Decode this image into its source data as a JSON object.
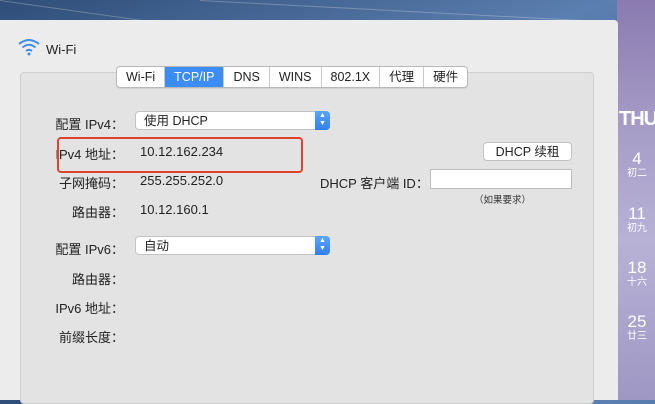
{
  "window": {
    "title": "Wi-Fi"
  },
  "tabs": [
    {
      "label": "Wi-Fi",
      "active": false
    },
    {
      "label": "TCP/IP",
      "active": true
    },
    {
      "label": "DNS",
      "active": false
    },
    {
      "label": "WINS",
      "active": false
    },
    {
      "label": "802.1X",
      "active": false
    },
    {
      "label": "代理",
      "active": false
    },
    {
      "label": "硬件",
      "active": false
    }
  ],
  "ipv4": {
    "config_label": "配置 IPv4：",
    "config_value": "使用 DHCP",
    "address_label": "IPv4 地址：",
    "address_value": "10.12.162.234",
    "subnet_label": "子网掩码：",
    "subnet_value": "255.255.252.0",
    "router_label": "路由器：",
    "router_value": "10.12.160.1",
    "renew_button": "DHCP 续租",
    "client_id_label": "DHCP 客户端 ID：",
    "client_id_value": "",
    "client_id_note": "（如果要求）"
  },
  "ipv6": {
    "config_label": "配置 IPv6：",
    "config_value": "自动",
    "router_label": "路由器：",
    "address_label": "IPv6 地址：",
    "prefix_label": "前缀长度："
  },
  "calendar": {
    "weekday": "THU",
    "days": [
      {
        "num": "4",
        "sub": "初二"
      },
      {
        "num": "11",
        "sub": "初九"
      },
      {
        "num": "18",
        "sub": "十六"
      },
      {
        "num": "25",
        "sub": "廿三"
      }
    ]
  },
  "colors": {
    "accent": "#3b8cf3",
    "highlight": "#e0432e"
  }
}
